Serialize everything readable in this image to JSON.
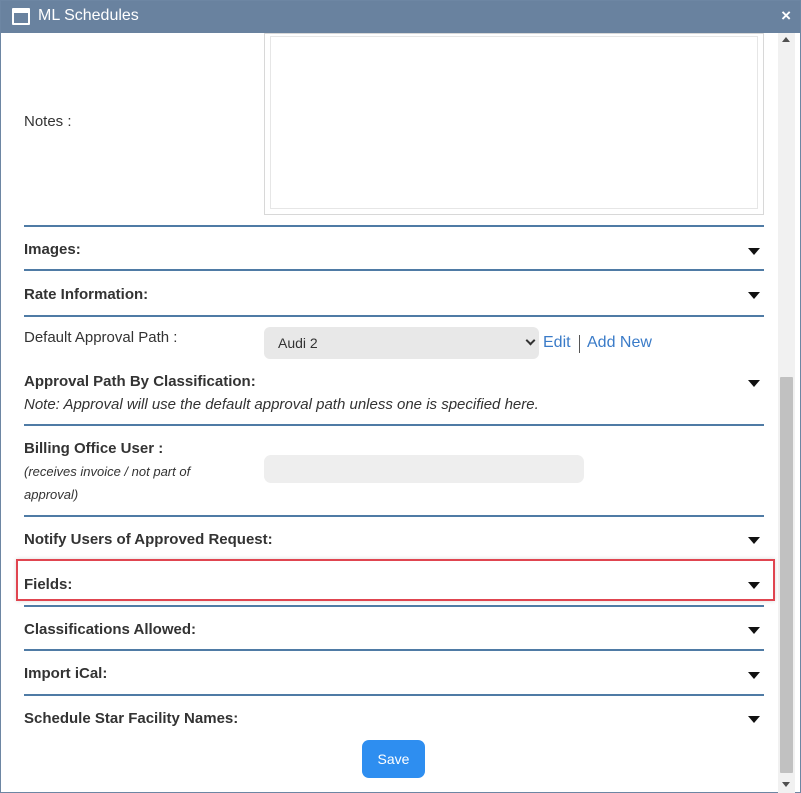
{
  "window": {
    "title": "ML Schedules",
    "close_glyph": "×",
    "icon": "window-icon"
  },
  "form": {
    "notes_label": "Notes :",
    "notes_value": "",
    "sections": {
      "images": "Images:",
      "rate_information": "Rate Information:",
      "approval_path_by_classification": "Approval Path By Classification:",
      "notify_users": "Notify Users of Approved Request:",
      "fields": "Fields:",
      "classifications_allowed": "Classifications Allowed:",
      "import_ical": "Import iCal:",
      "schedule_star_facility_names": "Schedule Star Facility Names:"
    },
    "default_approval_path": {
      "label": "Default Approval Path :",
      "selected": "Audi 2",
      "edit_link": "Edit",
      "add_new_link": "Add New"
    },
    "approval_note": "Note: Approval will use the default approval path unless one is specified here.",
    "billing_office_user": {
      "label": "Billing Office User :",
      "hint_line1": "(receives invoice / not part of",
      "hint_line2": "approval)",
      "value": ""
    },
    "save_label": "Save"
  },
  "colors": {
    "titlebar": "#69829f",
    "divider": "#4f7ba5",
    "link": "#3a7bc8",
    "save_button": "#2e8ef0",
    "highlight_border": "#e04550"
  }
}
